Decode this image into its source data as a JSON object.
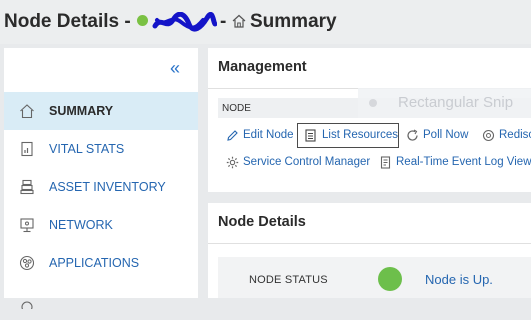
{
  "header": {
    "title": "Node Details -",
    "separator": "-",
    "breadcrumb_current": "Summary",
    "node_status_color": "#7ac143"
  },
  "sidebar": {
    "collapse_glyph": "«",
    "items": [
      {
        "label": "SUMMARY",
        "icon": "home-icon",
        "active": true
      },
      {
        "label": "VITAL STATS",
        "icon": "stats-document-icon",
        "active": false
      },
      {
        "label": "ASSET INVENTORY",
        "icon": "asset-inventory-icon",
        "active": false
      },
      {
        "label": "NETWORK",
        "icon": "network-monitor-icon",
        "active": false
      },
      {
        "label": "APPLICATIONS",
        "icon": "applications-icon",
        "active": false
      }
    ]
  },
  "management": {
    "title": "Management",
    "node_label": "NODE",
    "overlay_text": "Rectangular Snip",
    "actions": [
      {
        "label": "Edit Node",
        "icon": "pencil-icon"
      },
      {
        "label": "List Resources",
        "icon": "list-icon"
      },
      {
        "label": "Poll Now",
        "icon": "refresh-icon"
      },
      {
        "label": "Redisc",
        "icon": "rediscover-icon"
      },
      {
        "label": "Service Control Manager",
        "icon": "gear-icon"
      },
      {
        "label": "Real-Time Event Log Viewer",
        "icon": "event-log-icon"
      }
    ]
  },
  "details": {
    "title": "Node Details",
    "status_label": "NODE STATUS",
    "status_value": "Node is Up.",
    "status_color": "#6dbf4b"
  },
  "colors": {
    "link": "#2566b0",
    "active_nav_bg": "#d9ecf6",
    "page_bg": "#e8eaec"
  }
}
